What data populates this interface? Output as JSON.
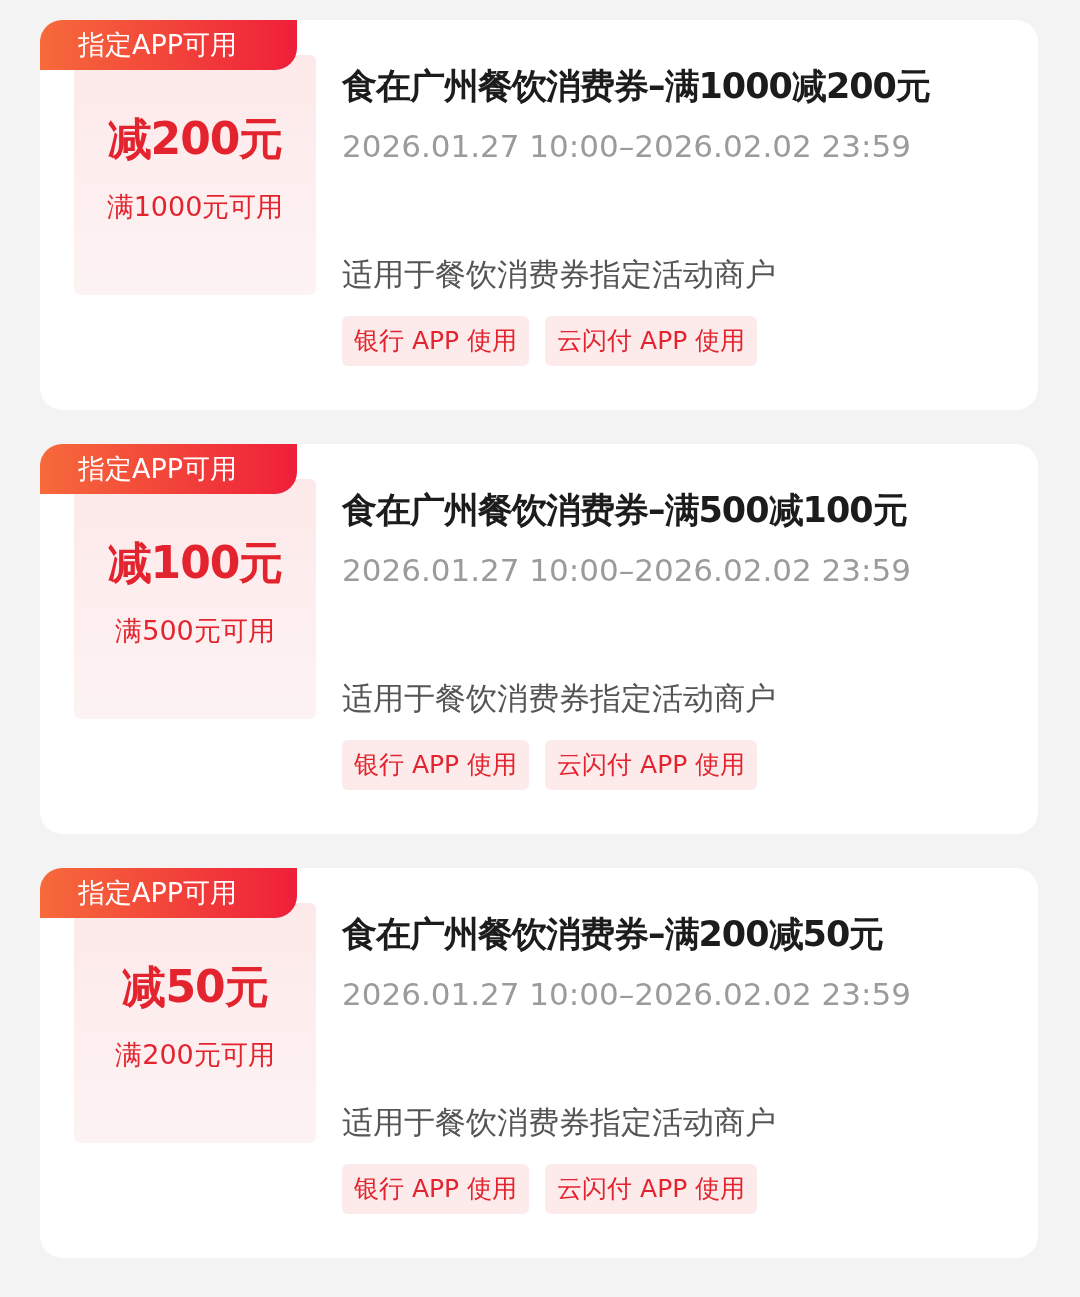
{
  "coupons": [
    {
      "badge": "指定APP可用",
      "amount": "减200元",
      "condition": "满1000元可用",
      "title": "食在广州餐饮消费券–满1000减200元",
      "validity": "2026.01.27 10:00–2026.02.02 23:59",
      "scope": "适用于餐饮消费券指定活动商户",
      "tags": [
        "银行 APP 使用",
        "云闪付 APP 使用"
      ]
    },
    {
      "badge": "指定APP可用",
      "amount": "减100元",
      "condition": "满500元可用",
      "title": "食在广州餐饮消费券–满500减100元",
      "validity": "2026.01.27 10:00–2026.02.02 23:59",
      "scope": "适用于餐饮消费券指定活动商户",
      "tags": [
        "银行 APP 使用",
        "云闪付 APP 使用"
      ]
    },
    {
      "badge": "指定APP可用",
      "amount": "减50元",
      "condition": "满200元可用",
      "title": "食在广州餐饮消费券–满200减50元",
      "validity": "2026.01.27 10:00–2026.02.02 23:59",
      "scope": "适用于餐饮消费券指定活动商户",
      "tags": [
        "银行 APP 使用",
        "云闪付 APP 使用"
      ]
    }
  ]
}
